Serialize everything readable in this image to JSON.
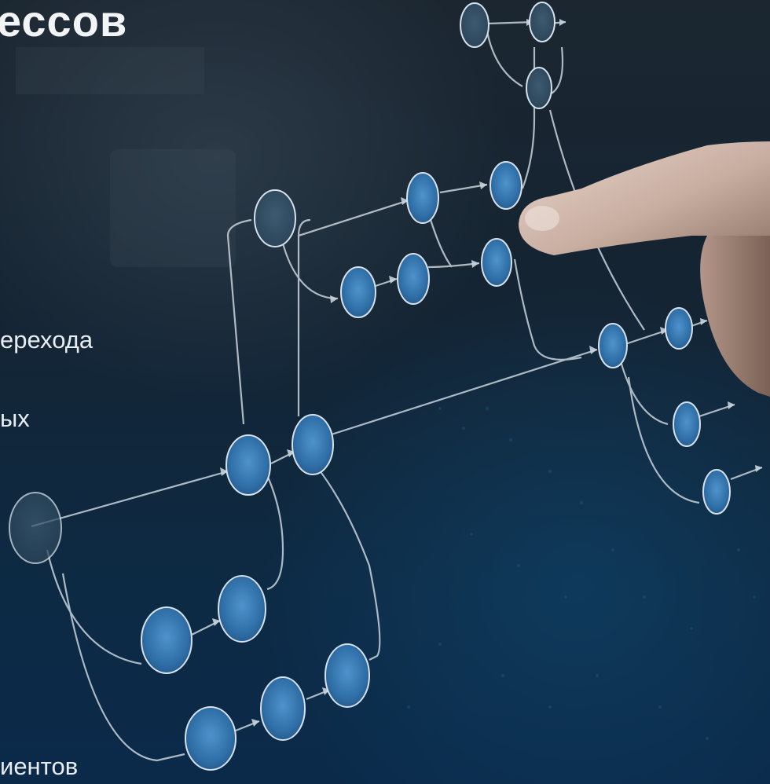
{
  "slide": {
    "title": "ессов",
    "bullets": [
      "ерехода",
      "ых",
      "иентов"
    ]
  },
  "image": {
    "subject": "hand touching a glowing process flowchart",
    "node_color": "#3f7fb8",
    "line_color": "#c9d3dc",
    "background_color": "#0d2a44"
  }
}
